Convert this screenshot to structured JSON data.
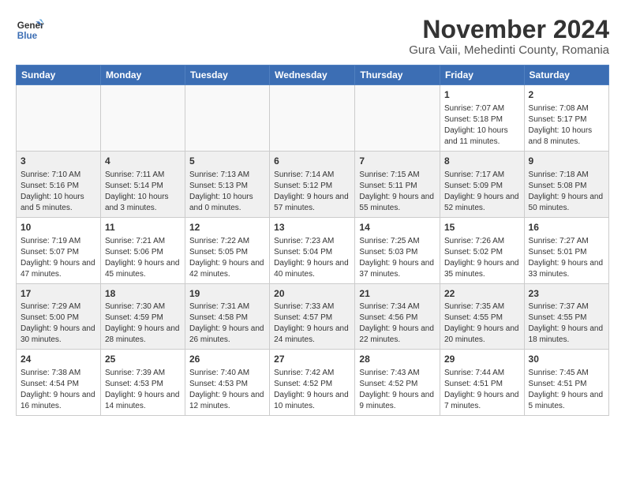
{
  "header": {
    "logo_line1": "General",
    "logo_line2": "Blue",
    "month_title": "November 2024",
    "location": "Gura Vaii, Mehedinti County, Romania"
  },
  "days_of_week": [
    "Sunday",
    "Monday",
    "Tuesday",
    "Wednesday",
    "Thursday",
    "Friday",
    "Saturday"
  ],
  "weeks": [
    [
      {
        "day": "",
        "info": ""
      },
      {
        "day": "",
        "info": ""
      },
      {
        "day": "",
        "info": ""
      },
      {
        "day": "",
        "info": ""
      },
      {
        "day": "",
        "info": ""
      },
      {
        "day": "1",
        "info": "Sunrise: 7:07 AM\nSunset: 5:18 PM\nDaylight: 10 hours and 11 minutes."
      },
      {
        "day": "2",
        "info": "Sunrise: 7:08 AM\nSunset: 5:17 PM\nDaylight: 10 hours and 8 minutes."
      }
    ],
    [
      {
        "day": "3",
        "info": "Sunrise: 7:10 AM\nSunset: 5:16 PM\nDaylight: 10 hours and 5 minutes."
      },
      {
        "day": "4",
        "info": "Sunrise: 7:11 AM\nSunset: 5:14 PM\nDaylight: 10 hours and 3 minutes."
      },
      {
        "day": "5",
        "info": "Sunrise: 7:13 AM\nSunset: 5:13 PM\nDaylight: 10 hours and 0 minutes."
      },
      {
        "day": "6",
        "info": "Sunrise: 7:14 AM\nSunset: 5:12 PM\nDaylight: 9 hours and 57 minutes."
      },
      {
        "day": "7",
        "info": "Sunrise: 7:15 AM\nSunset: 5:11 PM\nDaylight: 9 hours and 55 minutes."
      },
      {
        "day": "8",
        "info": "Sunrise: 7:17 AM\nSunset: 5:09 PM\nDaylight: 9 hours and 52 minutes."
      },
      {
        "day": "9",
        "info": "Sunrise: 7:18 AM\nSunset: 5:08 PM\nDaylight: 9 hours and 50 minutes."
      }
    ],
    [
      {
        "day": "10",
        "info": "Sunrise: 7:19 AM\nSunset: 5:07 PM\nDaylight: 9 hours and 47 minutes."
      },
      {
        "day": "11",
        "info": "Sunrise: 7:21 AM\nSunset: 5:06 PM\nDaylight: 9 hours and 45 minutes."
      },
      {
        "day": "12",
        "info": "Sunrise: 7:22 AM\nSunset: 5:05 PM\nDaylight: 9 hours and 42 minutes."
      },
      {
        "day": "13",
        "info": "Sunrise: 7:23 AM\nSunset: 5:04 PM\nDaylight: 9 hours and 40 minutes."
      },
      {
        "day": "14",
        "info": "Sunrise: 7:25 AM\nSunset: 5:03 PM\nDaylight: 9 hours and 37 minutes."
      },
      {
        "day": "15",
        "info": "Sunrise: 7:26 AM\nSunset: 5:02 PM\nDaylight: 9 hours and 35 minutes."
      },
      {
        "day": "16",
        "info": "Sunrise: 7:27 AM\nSunset: 5:01 PM\nDaylight: 9 hours and 33 minutes."
      }
    ],
    [
      {
        "day": "17",
        "info": "Sunrise: 7:29 AM\nSunset: 5:00 PM\nDaylight: 9 hours and 30 minutes."
      },
      {
        "day": "18",
        "info": "Sunrise: 7:30 AM\nSunset: 4:59 PM\nDaylight: 9 hours and 28 minutes."
      },
      {
        "day": "19",
        "info": "Sunrise: 7:31 AM\nSunset: 4:58 PM\nDaylight: 9 hours and 26 minutes."
      },
      {
        "day": "20",
        "info": "Sunrise: 7:33 AM\nSunset: 4:57 PM\nDaylight: 9 hours and 24 minutes."
      },
      {
        "day": "21",
        "info": "Sunrise: 7:34 AM\nSunset: 4:56 PM\nDaylight: 9 hours and 22 minutes."
      },
      {
        "day": "22",
        "info": "Sunrise: 7:35 AM\nSunset: 4:55 PM\nDaylight: 9 hours and 20 minutes."
      },
      {
        "day": "23",
        "info": "Sunrise: 7:37 AM\nSunset: 4:55 PM\nDaylight: 9 hours and 18 minutes."
      }
    ],
    [
      {
        "day": "24",
        "info": "Sunrise: 7:38 AM\nSunset: 4:54 PM\nDaylight: 9 hours and 16 minutes."
      },
      {
        "day": "25",
        "info": "Sunrise: 7:39 AM\nSunset: 4:53 PM\nDaylight: 9 hours and 14 minutes."
      },
      {
        "day": "26",
        "info": "Sunrise: 7:40 AM\nSunset: 4:53 PM\nDaylight: 9 hours and 12 minutes."
      },
      {
        "day": "27",
        "info": "Sunrise: 7:42 AM\nSunset: 4:52 PM\nDaylight: 9 hours and 10 minutes."
      },
      {
        "day": "28",
        "info": "Sunrise: 7:43 AM\nSunset: 4:52 PM\nDaylight: 9 hours and 9 minutes."
      },
      {
        "day": "29",
        "info": "Sunrise: 7:44 AM\nSunset: 4:51 PM\nDaylight: 9 hours and 7 minutes."
      },
      {
        "day": "30",
        "info": "Sunrise: 7:45 AM\nSunset: 4:51 PM\nDaylight: 9 hours and 5 minutes."
      }
    ]
  ]
}
